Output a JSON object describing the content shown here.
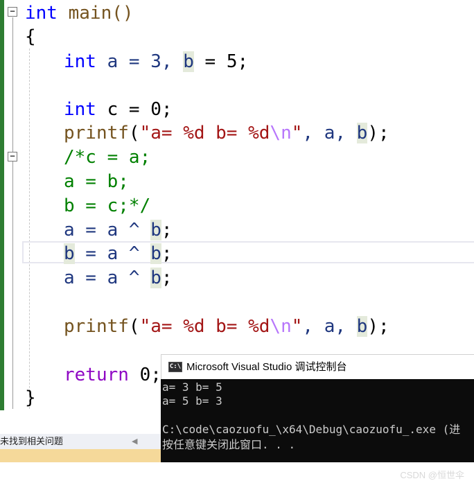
{
  "editor": {
    "lines": [
      {
        "l1": "int",
        "l2": " main()"
      },
      {
        "t": "{"
      },
      {
        "a1": "int",
        "a2": " a = 3, ",
        "a3": "b",
        "a4": " = 5;"
      },
      {
        "c1": "int",
        "c2": " c = 0;"
      },
      {
        "p1": "printf",
        "p2": "(",
        "p3": "\"a= %d b= %d",
        "p4": "\\n",
        "p5": "\"",
        "p6": ", a, ",
        "p7": "b",
        "p8": ");"
      },
      {
        "m1": "/*c = a;"
      },
      {
        "m2": "a = b;"
      },
      {
        "m3": "b = c;*/"
      },
      {
        "x1": "a",
        "x2": " = a ^ ",
        "x3": "b",
        "x4": ";"
      },
      {
        "y1": "b",
        "y2": " = a ^ ",
        "y3": "b",
        "y4": ";"
      },
      {
        "z1": "a",
        "z2": " = a ^ ",
        "z3": "b",
        "z4": ";"
      },
      {
        "q1": "printf",
        "q2": "(",
        "q3": "\"a= %d b= %d",
        "q4": "\\n",
        "q5": "\"",
        "q6": ", a, ",
        "q7": "b",
        "q8": ");"
      },
      {
        "r1": "return",
        "r2": " 0;"
      },
      {
        "t": "}"
      }
    ],
    "fold_minus": "−"
  },
  "status": {
    "text": "未找到相关问题",
    "arrow": "◀"
  },
  "console": {
    "icon": "C:\\",
    "title": "Microsoft Visual Studio 调试控制台",
    "lines": [
      "a= 3 b= 5",
      "a= 5 b= 3",
      "",
      "C:\\code\\caozuofu_\\x64\\Debug\\caozuofu_.exe (进",
      "按任意键关闭此窗口. . ."
    ],
    "watermark": "CSDN @恒世伞"
  },
  "colors": {
    "keyword": "#0000ff",
    "function": "#74531f",
    "string": "#a31515",
    "comment": "#008000",
    "variable": "#1f377f",
    "change_bar": "#2e7d32"
  }
}
